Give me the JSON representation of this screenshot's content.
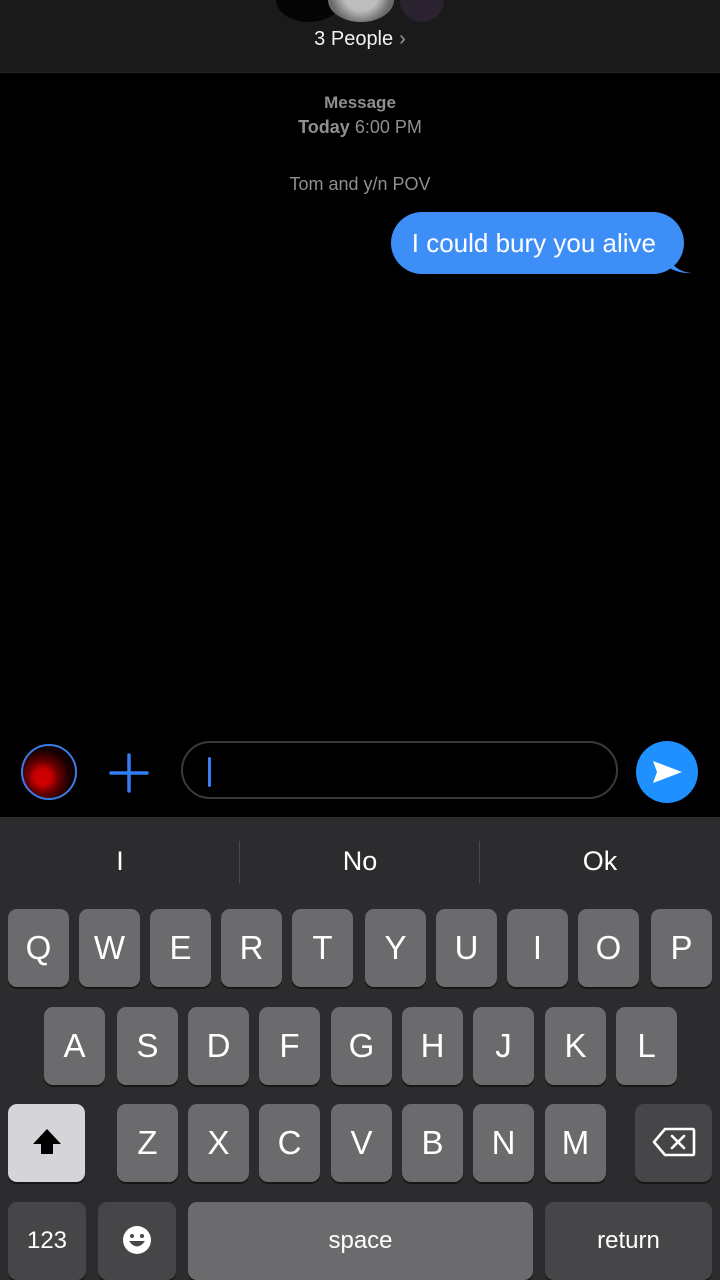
{
  "header": {
    "title": "3 People",
    "chevron": "›"
  },
  "meta": {
    "service": "Message",
    "day": "Today",
    "time": "6:00 PM",
    "note": "Tom and y/n POV"
  },
  "messages": [
    {
      "text": "I could bury you alive",
      "from": "me"
    }
  ],
  "compose": {
    "value": "",
    "placeholder": ""
  },
  "suggestions": [
    "I",
    "No",
    "Ok"
  ],
  "keyboard": {
    "row1": [
      "Q",
      "W",
      "E",
      "R",
      "T",
      "Y",
      "U",
      "I",
      "O",
      "P"
    ],
    "row2": [
      "A",
      "S",
      "D",
      "F",
      "G",
      "H",
      "J",
      "K",
      "L"
    ],
    "row3": [
      "Z",
      "X",
      "C",
      "V",
      "B",
      "N",
      "M"
    ],
    "numbers": "123",
    "space": "space",
    "return": "return"
  },
  "colors": {
    "bubble": "#3e8ef7",
    "accent": "#1e90ff",
    "keyboard_bg": "#2c2c2e"
  }
}
